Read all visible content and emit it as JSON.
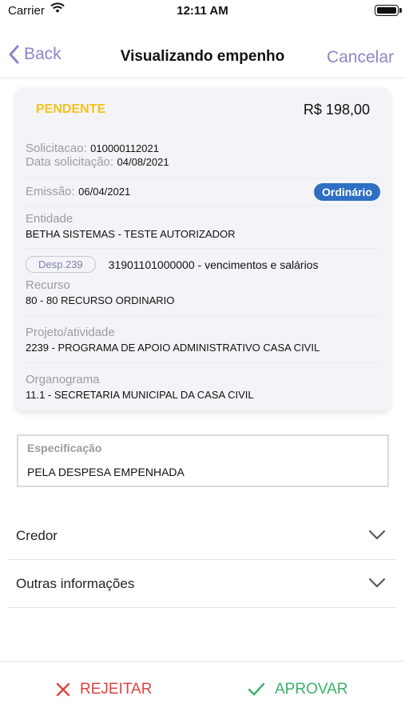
{
  "statusbar": {
    "carrier": "Carrier",
    "time": "12:11 AM"
  },
  "nav": {
    "back_label": "Back",
    "title": "Visualizando empenho",
    "cancel_label": "Cancelar"
  },
  "card": {
    "status": "PENDENTE",
    "amount": "R$ 198,00",
    "solicitacao_label": "Solicitacao:",
    "solicitacao_value": "010000112021",
    "data_solicitacao_label": "Data solicitação:",
    "data_solicitacao_value": "04/08/2021",
    "emissao_label": "Emissão:",
    "emissao_value": "06/04/2021",
    "tipo_badge": "Ordinário",
    "entidade_label": "Entidade",
    "entidade_value": "BETHA SISTEMAS - TESTE AUTORIZADOR",
    "despesa_badge": "Desp.239",
    "despesa_value": "31901101000000 - vencimentos e salários",
    "recurso_label": "Recurso",
    "recurso_value": "80 - 80 RECURSO ORDINARIO",
    "projeto_label": "Projeto/atividade",
    "projeto_value": "2239 - PROGRAMA DE APOIO ADMINISTRATIVO CASA CIVIL",
    "organograma_label": "Organograma",
    "organograma_value": "11.1 - SECRETARIA MUNICIPAL DA CASA CIVIL"
  },
  "spec": {
    "label": "Especificação",
    "value": "PELA DESPESA EMPENHADA"
  },
  "sections": [
    {
      "title": "Credor",
      "icon": "chevron-down-icon"
    },
    {
      "title": "Outras informações",
      "icon": "chevron-down-icon"
    }
  ],
  "actions": {
    "reject_label": "REJEITAR",
    "approve_label": "APROVAR"
  },
  "colors": {
    "accent": "#8b86c8",
    "pending": "#f3c21c",
    "badge": "#2e6fc4",
    "reject": "#e14141",
    "approve": "#38b26a"
  }
}
